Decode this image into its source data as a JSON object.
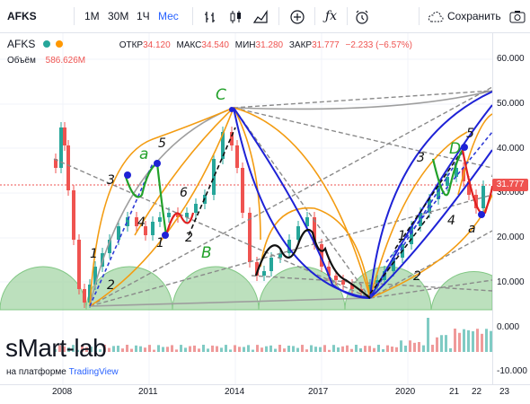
{
  "toolbar": {
    "symbol": "AFKS",
    "intervals": [
      "1М",
      "30М",
      "1Ч",
      "Мес"
    ],
    "save_label": "Сохранить"
  },
  "legend": {
    "symbol": "AFKS",
    "open_label": "ОТКР",
    "open": "34.120",
    "high_label": "МАКС",
    "high": "34.540",
    "low_label": "МИН",
    "low": "31.280",
    "close_label": "ЗАКР",
    "close": "31.777",
    "change": "−2.233 (−6.57%)",
    "volume_label": "Объём",
    "volume": "586.626M"
  },
  "price_axis": [
    "60.000",
    "50.000",
    "40.000",
    "30.000",
    "20.000",
    "10.000"
  ],
  "volume_axis": [
    "0.000",
    "-10.000"
  ],
  "time_axis": [
    "2008",
    "2011",
    "2014",
    "2017",
    "2020",
    "21",
    "22",
    "23"
  ],
  "last_price": "31.777",
  "annotations": {
    "green_letters": [
      "C",
      "a",
      "B",
      "D",
      "C",
      "b"
    ],
    "black_marks": [
      "5",
      "3",
      "4",
      "1",
      "2",
      "6",
      "2",
      "3",
      "5",
      "4",
      "1",
      "2",
      "B",
      "a",
      "c",
      "1"
    ]
  },
  "watermark": {
    "brand": "sMart-lab",
    "platform_prefix": "на платформе",
    "platform": "TradingView"
  },
  "colors": {
    "up": "#26a69a",
    "down": "#ef5350",
    "accent": "#2962ff",
    "circle_fill": "#a5d6a7"
  }
}
